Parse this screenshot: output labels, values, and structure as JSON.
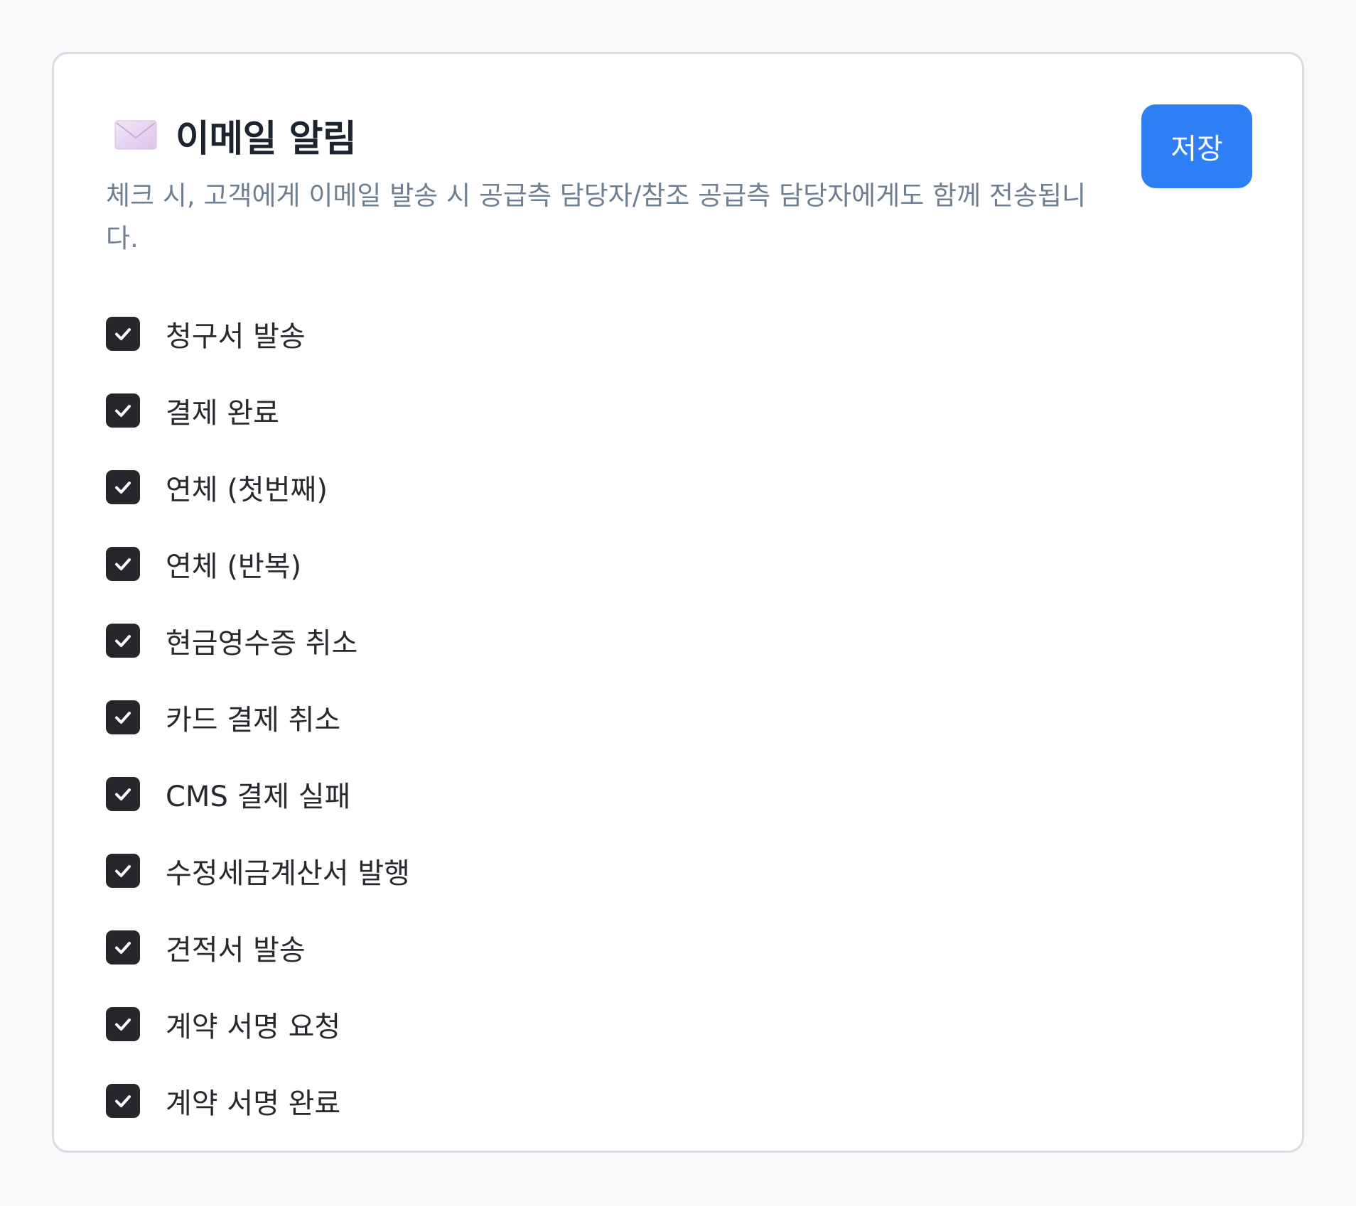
{
  "notifications": {
    "title": "이메일 알림",
    "icon": "envelope-icon",
    "description": "체크 시, 고객에게 이메일 발송 시 공급측 담당자/참조 공급측 담당자에게도 함께 전송됩니다.",
    "save_label": "저장",
    "accent_color": "#2f80f7",
    "items": [
      {
        "label": "청구서 발송",
        "checked": true
      },
      {
        "label": "결제 완료",
        "checked": true
      },
      {
        "label": "연체 (첫번째)",
        "checked": true
      },
      {
        "label": "연체 (반복)",
        "checked": true
      },
      {
        "label": "현금영수증 취소",
        "checked": true
      },
      {
        "label": "카드 결제 취소",
        "checked": true
      },
      {
        "label": "CMS 결제 실패",
        "checked": true
      },
      {
        "label": "수정세금계산서 발행",
        "checked": true
      },
      {
        "label": "견적서 발송",
        "checked": true
      },
      {
        "label": "계약 서명 요청",
        "checked": true
      },
      {
        "label": "계약 서명 완료",
        "checked": true
      }
    ]
  }
}
